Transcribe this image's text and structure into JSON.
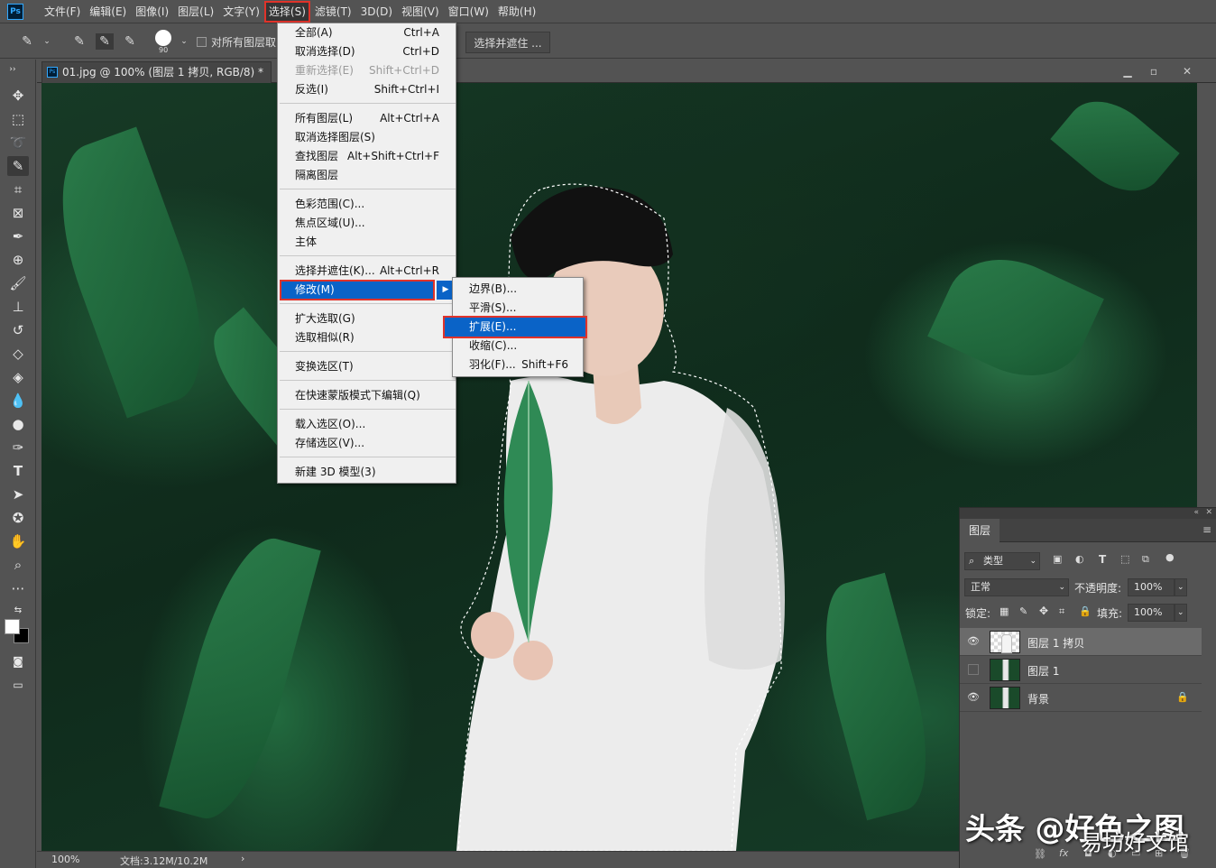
{
  "menubar": {
    "logo": "Ps",
    "items": [
      "文件(F)",
      "编辑(E)",
      "图像(I)",
      "图层(L)",
      "文字(Y)",
      "选择(S)",
      "滤镜(T)",
      "3D(D)",
      "视图(V)",
      "窗口(W)",
      "帮助(H)"
    ],
    "active_index": 5
  },
  "options": {
    "brush_size": "90",
    "sample_all_label": "对所有图层取",
    "select_and_mask": "选择并遮住 ..."
  },
  "document": {
    "tab_title": "01.jpg @ 100% (图层 1 拷贝, RGB/8) *",
    "tab_icon": "Ps",
    "zoom": "100%",
    "doc_size": "文档:3.12M/10.2M",
    "status_arrow": "›"
  },
  "select_menu": {
    "items": [
      {
        "label": "全部(A)",
        "shortcut": "Ctrl+A"
      },
      {
        "label": "取消选择(D)",
        "shortcut": "Ctrl+D"
      },
      {
        "label": "重新选择(E)",
        "shortcut": "Shift+Ctrl+D",
        "disabled": true
      },
      {
        "label": "反选(I)",
        "shortcut": "Shift+Ctrl+I"
      },
      {
        "label": "所有图层(L)",
        "shortcut": "Alt+Ctrl+A"
      },
      {
        "label": "取消选择图层(S)",
        "shortcut": ""
      },
      {
        "label": "查找图层",
        "shortcut": "Alt+Shift+Ctrl+F"
      },
      {
        "label": "隔离图层",
        "shortcut": ""
      },
      {
        "label": "色彩范围(C)...",
        "shortcut": ""
      },
      {
        "label": "焦点区域(U)...",
        "shortcut": ""
      },
      {
        "label": "主体",
        "shortcut": ""
      },
      {
        "label": "选择并遮住(K)...",
        "shortcut": "Alt+Ctrl+R"
      },
      {
        "label": "修改(M)",
        "shortcut": "",
        "highlighted": true
      },
      {
        "label": "扩大选取(G)",
        "shortcut": ""
      },
      {
        "label": "选取相似(R)",
        "shortcut": ""
      },
      {
        "label": "变换选区(T)",
        "shortcut": ""
      },
      {
        "label": "在快速蒙版模式下编辑(Q)",
        "shortcut": ""
      },
      {
        "label": "载入选区(O)...",
        "shortcut": ""
      },
      {
        "label": "存储选区(V)...",
        "shortcut": ""
      },
      {
        "label": "新建 3D 模型(3)",
        "shortcut": ""
      }
    ]
  },
  "modify_submenu": {
    "items": [
      {
        "label": "边界(B)...",
        "shortcut": ""
      },
      {
        "label": "平滑(S)...",
        "shortcut": ""
      },
      {
        "label": "扩展(E)...",
        "shortcut": "",
        "highlighted": true
      },
      {
        "label": "收缩(C)...",
        "shortcut": ""
      },
      {
        "label": "羽化(F)...",
        "shortcut": "Shift+F6"
      }
    ]
  },
  "layers_panel": {
    "tab": "图层",
    "filter_kind": "类型",
    "blend_mode": "正常",
    "opacity_label": "不透明度:",
    "opacity_value": "100%",
    "lock_label": "锁定:",
    "fill_label": "填充:",
    "fill_value": "100%",
    "layers": [
      {
        "name": "图层 1 拷贝",
        "visible": true,
        "selected": true
      },
      {
        "name": "图层 1",
        "visible": false,
        "selected": false
      },
      {
        "name": "背景",
        "visible": true,
        "selected": false,
        "locked": true
      }
    ],
    "bottom_icons": [
      "link-icon",
      "fx-icon",
      "mask-icon",
      "adjustment-icon",
      "folder-icon",
      "new-layer-icon",
      "trash-icon"
    ],
    "bottom_fx": "fx"
  },
  "watermark": {
    "line1": "头条 @好色之图",
    "line2": "易坊好文馆"
  }
}
